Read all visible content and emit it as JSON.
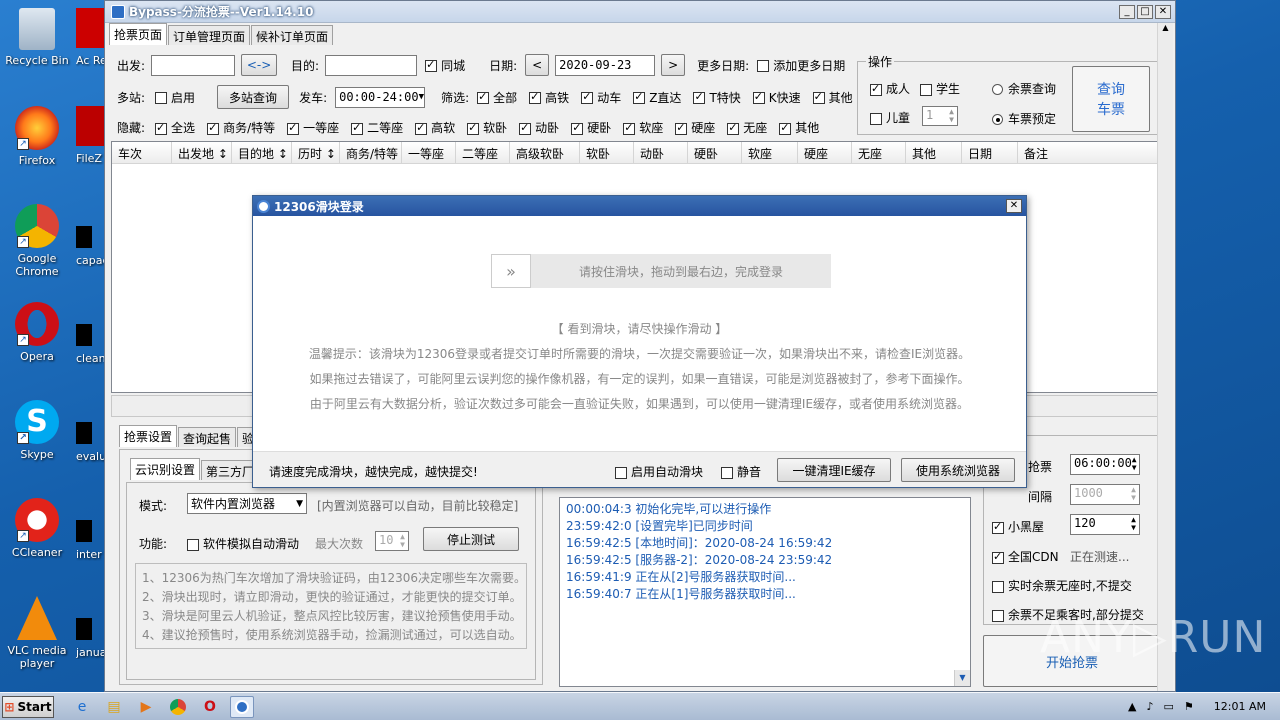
{
  "desktop": {
    "icons": [
      {
        "label": "Recycle Bin"
      },
      {
        "label": "Firefox"
      },
      {
        "label": "Google Chrome"
      },
      {
        "label": "Opera"
      },
      {
        "label": "Skype"
      },
      {
        "label": "CCleaner"
      },
      {
        "label": "VLC media player"
      }
    ],
    "icons2": [
      "Ac Rea",
      "FileZ",
      "capac",
      "clean",
      "evalu",
      "inter",
      "janua"
    ]
  },
  "window": {
    "title": "Bypass-分流抢票--Ver1.14.10",
    "tabs": [
      "抢票页面",
      "订单管理页面",
      "候补订单页面"
    ],
    "form": {
      "from_label": "出发:",
      "from_value": "",
      "swap": "<->",
      "to_label": "目的:",
      "to_value": "",
      "same_city": "同城",
      "date_label": "日期:",
      "date_value": "2020-09-23",
      "prev": "<",
      "next": ">",
      "more_dates_label": "更多日期:",
      "add_more_dates": "添加更多日期",
      "multi_station_label": "多站:",
      "enable": "启用",
      "multi_query": "多站查询",
      "depart_label": "发车:",
      "depart_value": "00:00-24:00",
      "filter_label": "筛选:",
      "filters": [
        "全部",
        "高铁",
        "动车",
        "Z直达",
        "T特快",
        "K快速",
        "其他"
      ],
      "hide_label": "隐藏:",
      "hides": [
        "全选",
        "商务/特等",
        "一等座",
        "二等座",
        "高软",
        "软卧",
        "动卧",
        "硬卧",
        "软座",
        "硬座",
        "无座",
        "其他"
      ]
    },
    "ops": {
      "title": "操作",
      "adult": "成人",
      "student": "学生",
      "child": "儿童",
      "child_count": "1",
      "remain_query": "余票查询",
      "reserve": "车票预定",
      "query_btn_1": "查询",
      "query_btn_2": "车票"
    },
    "grid_columns": [
      "车次",
      "出发地 ↕",
      "目的地 ↕",
      "历时 ↕",
      "商务/特等",
      "一等座",
      "二等座",
      "高级软卧",
      "软卧",
      "动卧",
      "硬卧",
      "软座",
      "硬座",
      "无座",
      "其他",
      "日期",
      "备注"
    ],
    "lower": {
      "tabs": [
        "抢票设置",
        "查询起售",
        "验"
      ],
      "subtabs": [
        "云识别设置",
        "第三方厂"
      ],
      "mode_label": "模式:",
      "mode_value": "软件内置浏览器",
      "mode_hint": "[内置浏览器可以自动，目前比较稳定]",
      "func_label": "功能:",
      "auto_slide": "软件模拟自动滑动",
      "max_label": "最大次数",
      "max_value": "10",
      "stop_test": "停止测试",
      "notes": [
        "1、12306为热门车次增加了滑块验证码，由12306决定哪些车次需要。",
        "2、滑块出现时，请立即滑动，更快的验证通过，才能更快的提交订单。",
        "3、滑块是阿里云人机验证，整点风控比较厉害，建议抢预售使用手动。",
        "4、建议抢预售时，使用系统浏览器手动，捡漏测试通过，可以选自动。"
      ],
      "log": [
        "00:00:04:3  初始化完毕,可以进行操作",
        "23:59:42:0  [设置完毕]已同步时间",
        "16:59:42:5  [本地时间]：2020-08-24 16:59:42",
        "16:59:42:5  [服务器-2]：2020-08-24 23:59:42",
        "16:59:41:9  正在从[2]号服务器获取时间...",
        "16:59:40:7  正在从[1]号服务器获取时间..."
      ],
      "right": {
        "grab_label": "抢票",
        "grab_time": "06:00:00",
        "interval_label": "间隔",
        "interval_value": "1000",
        "blackroom": "小黑屋",
        "blackroom_value": "120",
        "cdn": "全国CDN",
        "cdn_status": "正在测速...",
        "realtime": "实时余票无座时,不提交",
        "partial": "余票不足乘客时,部分提交",
        "start": "开始抢票"
      }
    }
  },
  "dialog": {
    "title": "12306滑块登录",
    "slider_text": "请按住滑块，拖动到最右边，完成登录",
    "slider_icon": "»",
    "tips": [
      "【 看到滑块，请尽快操作滑动 】",
      "温馨提示：该滑块为12306登录或者提交订单时所需要的滑块，一次提交需要验证一次，如果滑块出不来，请检查IE浏览器。",
      "如果拖过去错误了，可能阿里云误判您的操作像机器，有一定的误判，如果一直错误，可能是浏览器被封了，参考下面操作。",
      "由于阿里云有大数据分析，验证次数过多可能会一直验证失败，如果遇到，可以使用一键清理IE缓存，或者使用系统浏览器。"
    ],
    "footer_text": "请速度完成滑块，越快完成，越快提交!",
    "auto_slide": "启用自动滑块",
    "mute": "静音",
    "clear_ie": "一键清理IE缓存",
    "use_browser": "使用系统浏览器"
  },
  "taskbar": {
    "start": "Start",
    "time": "12:01 AM"
  },
  "watermark": "ANY▷RUN"
}
